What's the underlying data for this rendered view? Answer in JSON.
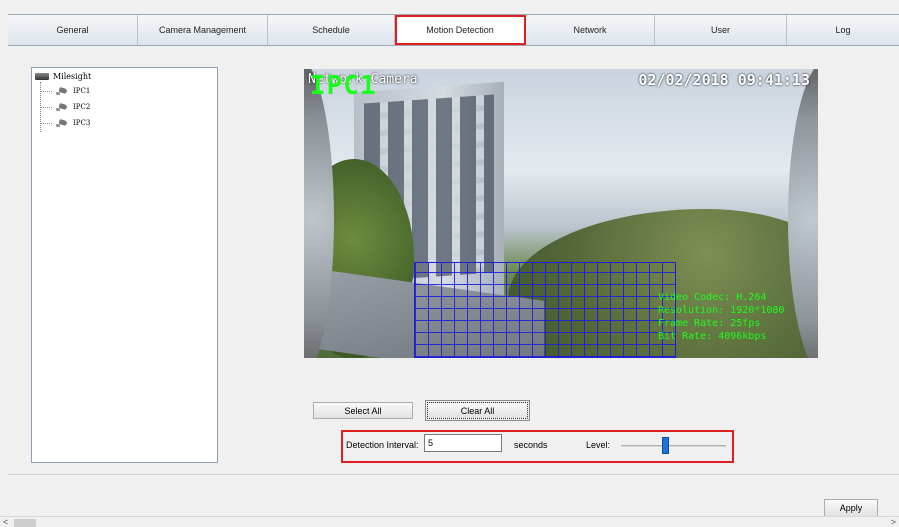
{
  "tabs": [
    {
      "label": "General",
      "active": false
    },
    {
      "label": "Camera Management",
      "active": false
    },
    {
      "label": "Schedule",
      "active": false
    },
    {
      "label": "Motion Detection",
      "active": true
    },
    {
      "label": "Network",
      "active": false
    },
    {
      "label": "User",
      "active": false
    },
    {
      "label": "Log",
      "active": false
    }
  ],
  "tree": {
    "root_label": "Milesight",
    "items": [
      "IPC1",
      "IPC2",
      "IPC3"
    ]
  },
  "video": {
    "osd_ipc": "IPC1",
    "osd_camera_name": "Network Camera",
    "osd_timestamp": "02/02/2018 09:41:13",
    "osd_stats": "Video Codec: H.264\nResolution: 1920*1080\nFrame Rate: 25fps\nBit Rate: 4096kbps"
  },
  "buttons": {
    "select_all": "Select All",
    "clear_all": "Clear All",
    "apply": "Apply"
  },
  "detection": {
    "interval_label": "Detection Interval:",
    "interval_value": "5",
    "interval_unit": "seconds",
    "level_label": "Level:",
    "level_fraction": 0.42
  },
  "scrollbar": {
    "left_arrow": "<",
    "right_arrow": ">"
  },
  "colors": {
    "highlight_border": "#e02020",
    "osd_green": "#19ff19",
    "slider_thumb": "#1e73d8",
    "motion_grid": "#2020d0"
  }
}
